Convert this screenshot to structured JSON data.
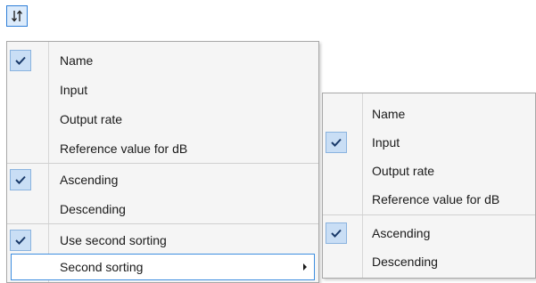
{
  "toolbar": {
    "sort_icon": "sort-arrows-icon"
  },
  "main_menu": {
    "items": [
      {
        "label": "Name",
        "checked": true
      },
      {
        "label": "Input",
        "checked": false
      },
      {
        "label": "Output rate",
        "checked": false
      },
      {
        "label": "Reference value for dB",
        "checked": false
      },
      {
        "label": "Ascending",
        "checked": true
      },
      {
        "label": "Descending",
        "checked": false
      },
      {
        "label": "Use second sorting",
        "checked": true
      },
      {
        "label": "Second sorting",
        "checked": false,
        "has_submenu": true,
        "highlighted": true
      }
    ]
  },
  "sub_menu": {
    "items": [
      {
        "label": "Name",
        "checked": false
      },
      {
        "label": "Input",
        "checked": true
      },
      {
        "label": "Output rate",
        "checked": false
      },
      {
        "label": "Reference value for dB",
        "checked": false
      },
      {
        "label": "Ascending",
        "checked": true
      },
      {
        "label": "Descending",
        "checked": false
      }
    ]
  },
  "colors": {
    "check_fill": "#c9def5",
    "check_border": "#8ab3df",
    "highlight_border": "#3d8ee0",
    "menu_bg": "#f5f5f5"
  }
}
